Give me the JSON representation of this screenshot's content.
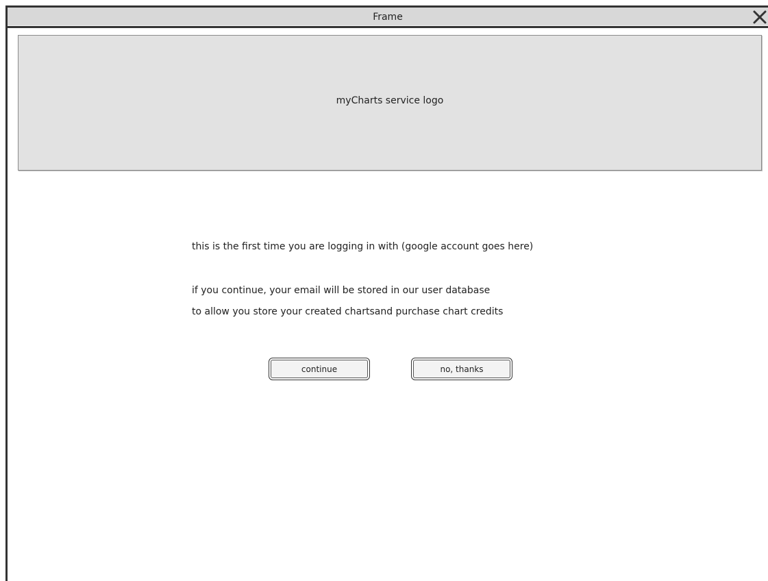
{
  "window": {
    "title": "Frame",
    "close_icon": "close-icon"
  },
  "logo": {
    "label": "myCharts service logo"
  },
  "message": {
    "line1": "this is the first time you are logging in with (google account goes here)",
    "line2": "if you continue, your email will be stored in our user database",
    "line3": "to allow you store your created chartsand purchase chart credits"
  },
  "buttons": {
    "continue_label": "continue",
    "no_thanks_label": "no, thanks"
  }
}
